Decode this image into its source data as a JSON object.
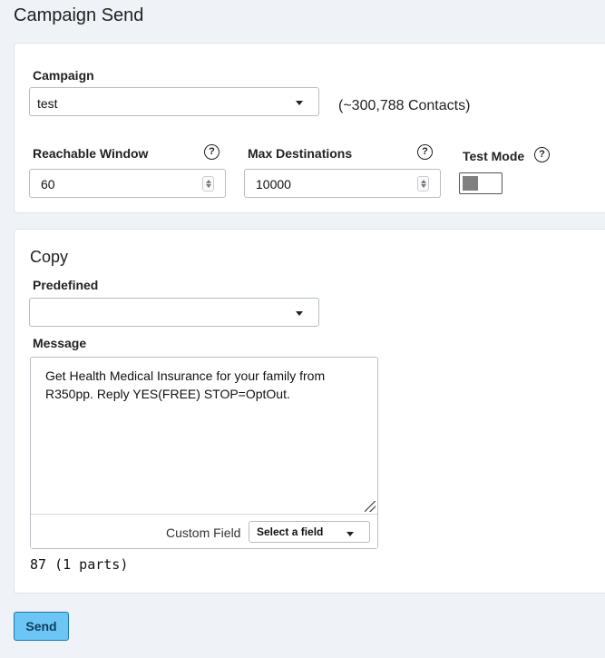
{
  "page": {
    "title": "Campaign Send"
  },
  "campaign": {
    "label": "Campaign",
    "value": "test",
    "contacts_text": "(~300,788 Contacts)"
  },
  "reachable_window": {
    "label": "Reachable Window",
    "value": "60"
  },
  "max_destinations": {
    "label": "Max Destinations",
    "value": "10000"
  },
  "test_mode": {
    "label": "Test Mode",
    "enabled": false
  },
  "help_icon": {
    "glyph": "?"
  },
  "copy": {
    "title": "Copy",
    "predefined_label": "Predefined",
    "predefined_value": "",
    "message_label": "Message",
    "message_text": "Get Health Medical Insurance for your family from R350pp. Reply YES(FREE) STOP=OptOut.",
    "custom_field_label": "Custom Field",
    "custom_field_value": "Select a field",
    "char_count": "87 (1 parts)"
  },
  "actions": {
    "send_label": "Send"
  },
  "colors": {
    "background": "#eff2f7",
    "send_button": "#6cc6f5",
    "send_border": "#1f78ab",
    "toggle_knob": "#808080"
  }
}
